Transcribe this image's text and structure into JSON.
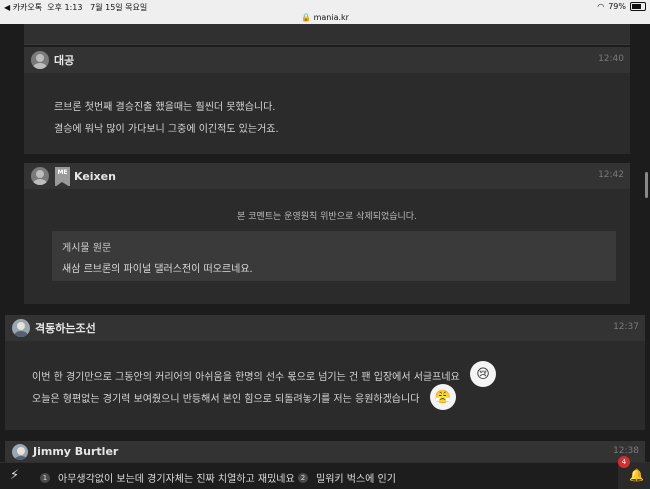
{
  "status_bar": {
    "back_app": "◀ 카카오톡",
    "clock": "오후 1:13",
    "date": "7월 15일 목요일",
    "battery": "79%",
    "url": "mania.kr"
  },
  "comments": [
    {
      "author": "대공",
      "time": "12:40",
      "lines": [
        "르브론 첫번째 결승진출 했을때는 훨씬더 못했습니다.",
        "결승에 워낙 많이 가다보니 그중에 이긴적도 있는거죠."
      ]
    },
    {
      "author": "Keixen",
      "badge": "ME",
      "time": "12:42",
      "deleted_notice": "본 코멘트는 운영원칙 위반으로 삭제되었습니다.",
      "quote": {
        "title": "게시물 원문",
        "text": "새삼 르브론의 파이널 댈러스전이 떠오르네요."
      }
    },
    {
      "author": "격동하는조선",
      "time": "12:37",
      "lines": [
        "이번 한 경기만으로 그동안의 커리어의 아쉬움을 한명의 선수 몫으로 넘기는 건 팬 입장에서 서글프네요",
        "오늘은 형편없는 경기력 보여줬으니 반등해서 본인 힘으로 되돌려놓기를 저는 응원하겠습니다"
      ]
    },
    {
      "author": "Jimmy Burtler",
      "time": "12:38"
    }
  ],
  "bottom_bar": {
    "trending": [
      {
        "rank": "1",
        "text": "아무생각없이 보는데 경기자체는 진짜 치열하고 재밌네요"
      },
      {
        "rank": "2",
        "text": "밀워키 벅스에 인기"
      }
    ],
    "notification_count": "4"
  },
  "icons": {
    "wifi": "wifi-icon",
    "lock": "lock-icon",
    "bolt": "bolt-icon",
    "bell": "bell-icon"
  }
}
